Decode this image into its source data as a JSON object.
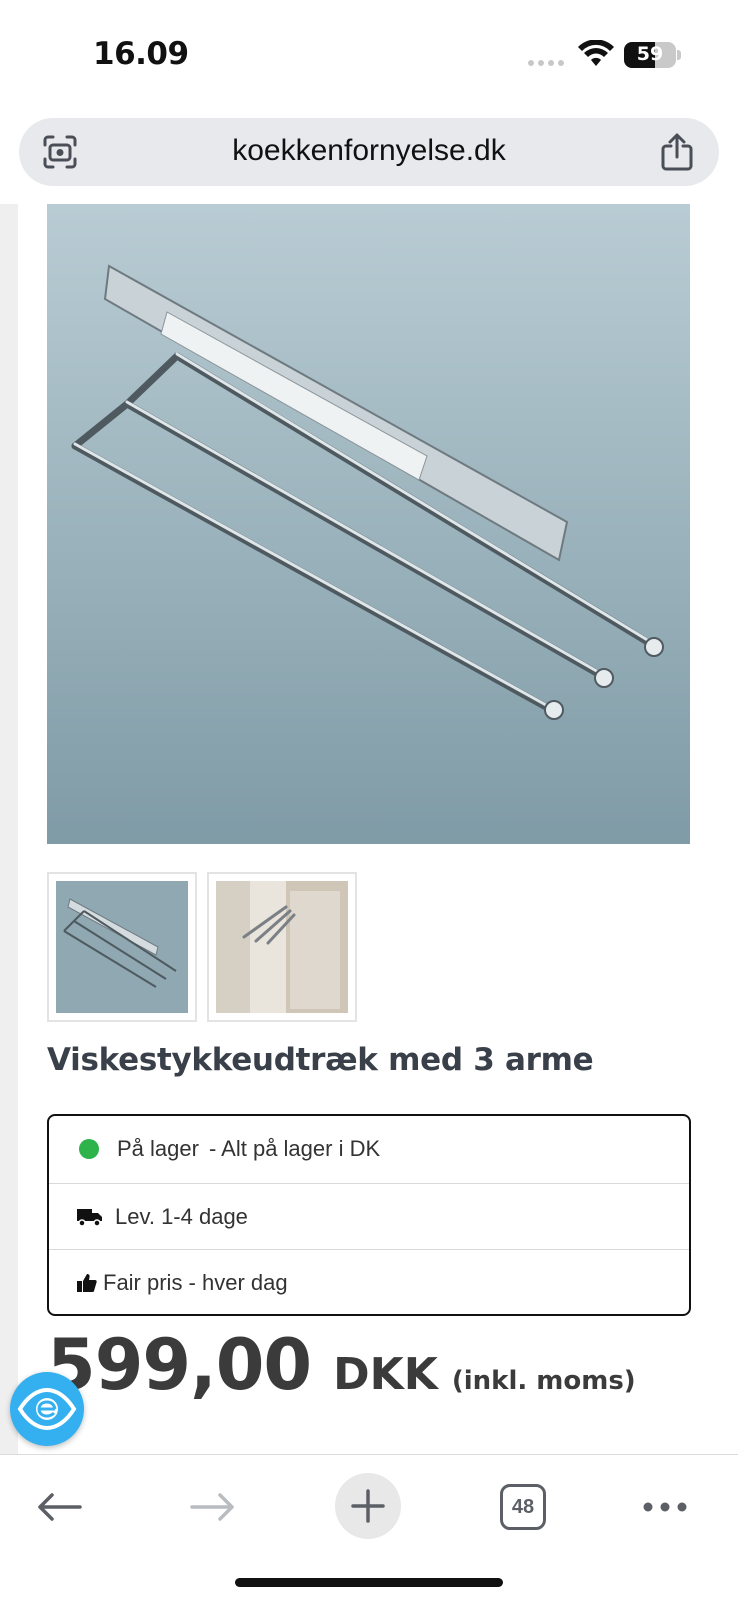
{
  "status_bar": {
    "time": "16.09",
    "battery": "59"
  },
  "address_bar": {
    "url": "koekkenfornyelse.dk"
  },
  "product": {
    "title": "Viskestykkeudtræk med 3 arme",
    "stock_label": "På lager",
    "stock_detail": "- Alt på lager i DK",
    "delivery": "Lev. 1-4 dage",
    "fair_price": "Fair pris - hver dag",
    "price": "599,00",
    "currency": "DKK",
    "vat_note": "(inkl. moms)",
    "stock_color": "#2db34a"
  },
  "toolbar": {
    "tab_count": "48"
  },
  "colors": {
    "accessibility_button": "#34b0f0",
    "address_bar_bg": "#e7e9ec"
  }
}
